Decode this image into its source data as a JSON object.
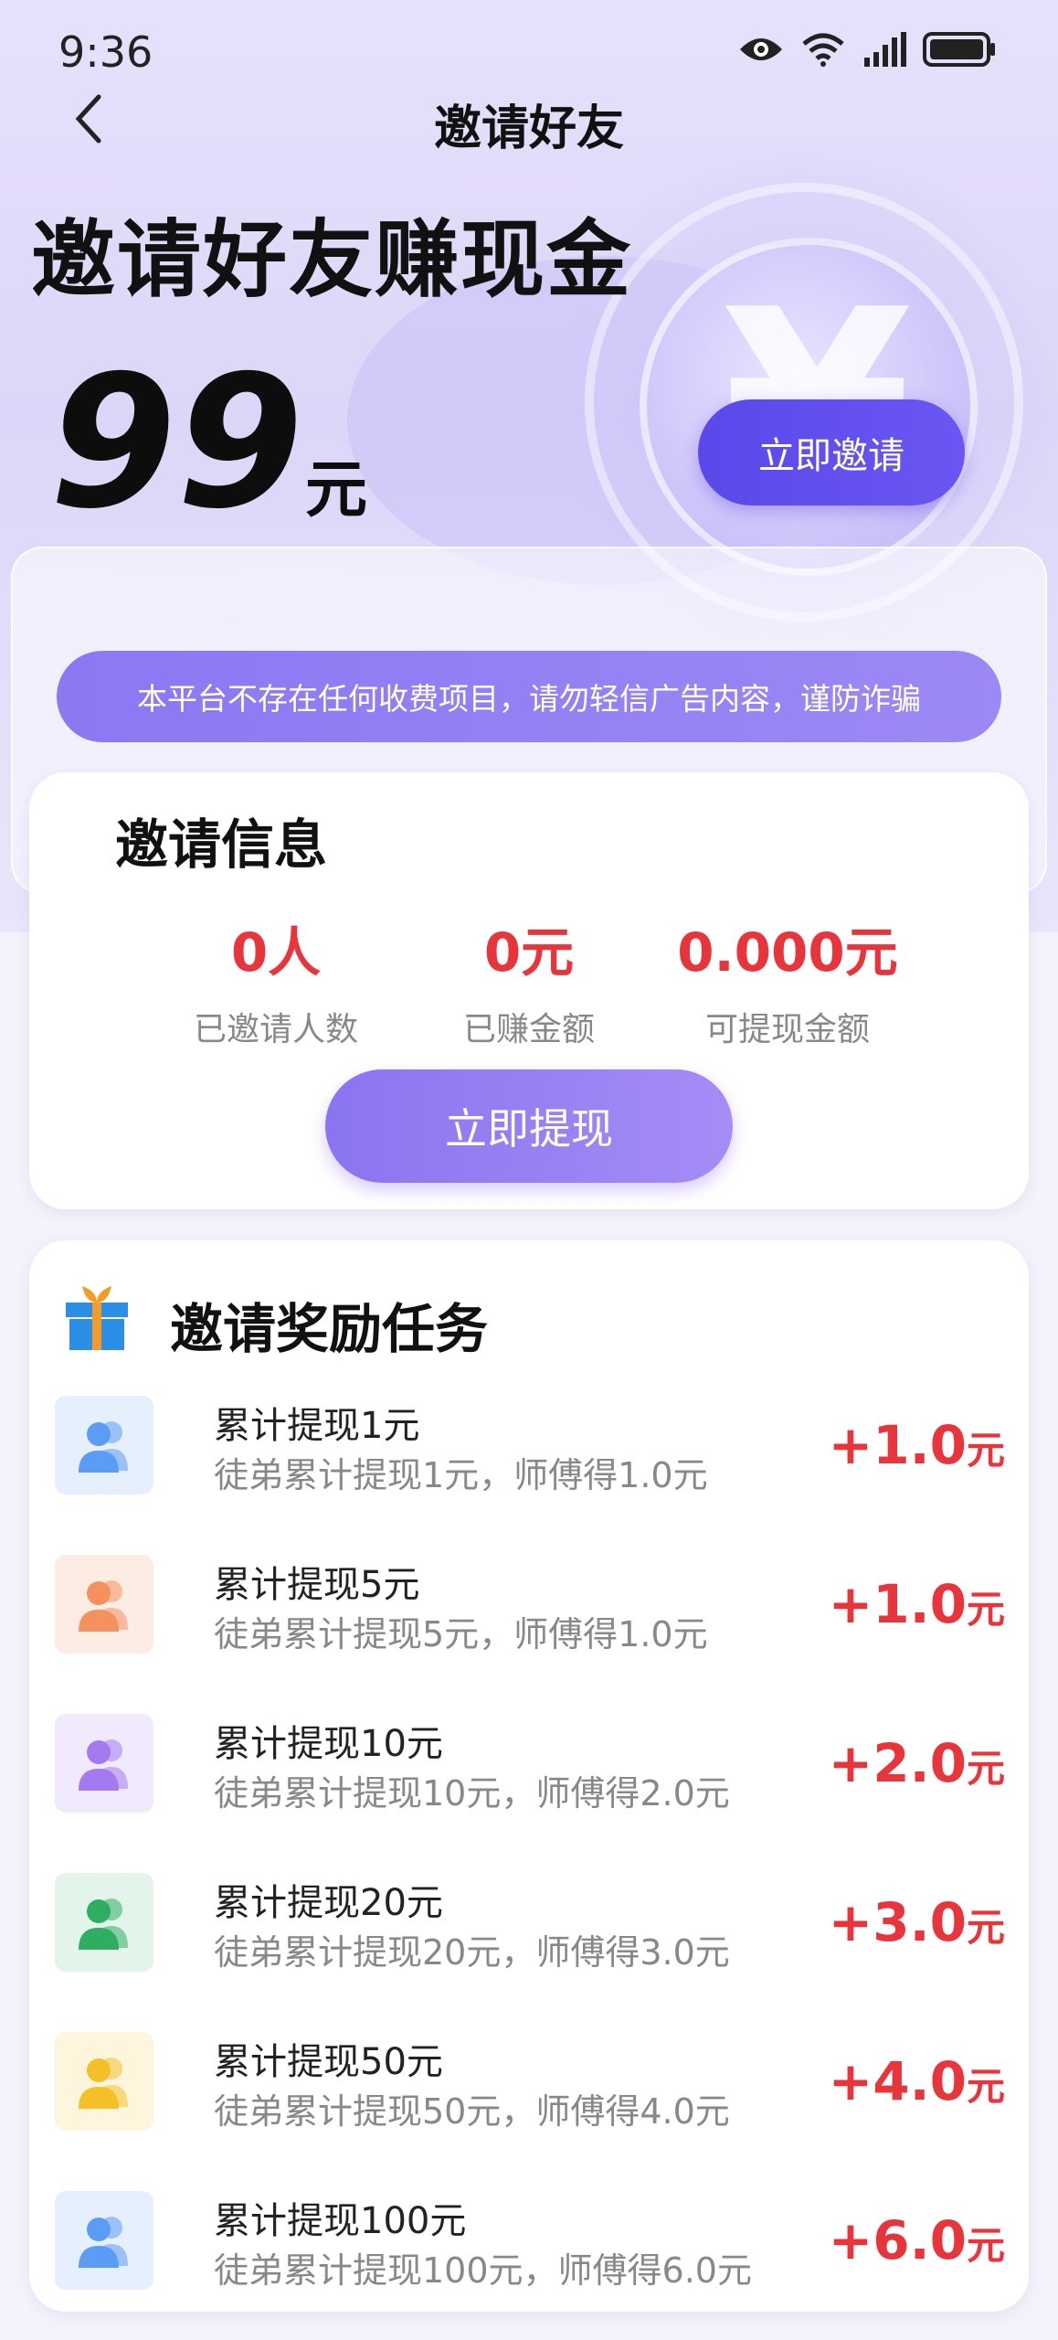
{
  "status_bar": {
    "time": "9:36",
    "icons": [
      "eye-icon",
      "wifi-icon",
      "signal-icon",
      "battery-icon"
    ]
  },
  "nav": {
    "title": "邀请好友",
    "back_icon": "chevron-left-icon"
  },
  "hero": {
    "title": "邀请好友赚现金",
    "amount": "99",
    "amount_unit": "元",
    "invite_button": "立即邀请"
  },
  "notice": "本平台不存在任何收费项目，请勿轻信广告内容，谨防诈骗",
  "invite_info": {
    "title": "邀请信息",
    "stats": [
      {
        "value": "0人",
        "label": "已邀请人数"
      },
      {
        "value": "0元",
        "label": "已赚金额"
      },
      {
        "value": "0.000元",
        "label": "可提现金额"
      }
    ],
    "withdraw_button": "立即提现"
  },
  "tasks": {
    "title": "邀请奖励任务",
    "items": [
      {
        "name": "累计提现1元",
        "desc": "徒弟累计提现1元，师傅得1.0元",
        "reward": "+1.0",
        "unit": "元",
        "icon_color": "#5b9df5",
        "icon_bg": "#e6f0fd"
      },
      {
        "name": "累计提现5元",
        "desc": "徒弟累计提现5元，师傅得1.0元",
        "reward": "+1.0",
        "unit": "元",
        "icon_color": "#f4915f",
        "icon_bg": "#fdece3"
      },
      {
        "name": "累计提现10元",
        "desc": "徒弟累计提现10元，师傅得2.0元",
        "reward": "+2.0",
        "unit": "元",
        "icon_color": "#a47af0",
        "icon_bg": "#f1eafc"
      },
      {
        "name": "累计提现20元",
        "desc": "徒弟累计提现20元，师傅得3.0元",
        "reward": "+3.0",
        "unit": "元",
        "icon_color": "#2fae62",
        "icon_bg": "#e3f5ea"
      },
      {
        "name": "累计提现50元",
        "desc": "徒弟累计提现50元，师傅得4.0元",
        "reward": "+4.0",
        "unit": "元",
        "icon_color": "#f3c02a",
        "icon_bg": "#fdf6dd"
      },
      {
        "name": "累计提现100元",
        "desc": "徒弟累计提现100元，师傅得6.0元",
        "reward": "+6.0",
        "unit": "元",
        "icon_color": "#5b9df5",
        "icon_bg": "#e6f0fd"
      }
    ]
  },
  "colors": {
    "accent": "#5a48ea",
    "reward_red": "#e8353b"
  }
}
